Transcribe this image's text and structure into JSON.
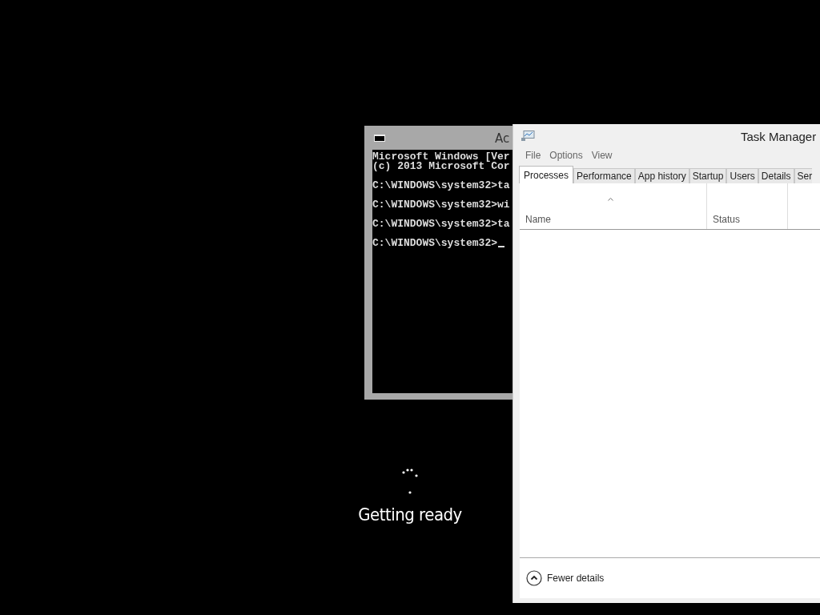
{
  "console_window": {
    "title": "Ac",
    "blocks": [
      [
        "Microsoft Windows [Ver",
        "(c) 2013 Microsoft Cor"
      ],
      [
        "C:\\WINDOWS\\system32>ta"
      ],
      [
        "C:\\WINDOWS\\system32>wi"
      ],
      [
        "C:\\WINDOWS\\system32>ta"
      ],
      [
        "C:\\WINDOWS\\system32>"
      ]
    ],
    "cursor": true
  },
  "task_manager": {
    "title": "Task Manager",
    "menu": [
      "File",
      "Options",
      "View"
    ],
    "tabs": [
      {
        "label": "Processes",
        "selected": true
      },
      {
        "label": "Performance",
        "selected": false
      },
      {
        "label": "App history",
        "selected": false
      },
      {
        "label": "Startup",
        "selected": false
      },
      {
        "label": "Users",
        "selected": false
      },
      {
        "label": "Details",
        "selected": false
      },
      {
        "label": "Ser",
        "selected": false
      }
    ],
    "columns": [
      "Name",
      "Status"
    ],
    "footer": "Fewer details"
  },
  "boot_status": {
    "text": "Getting ready"
  }
}
